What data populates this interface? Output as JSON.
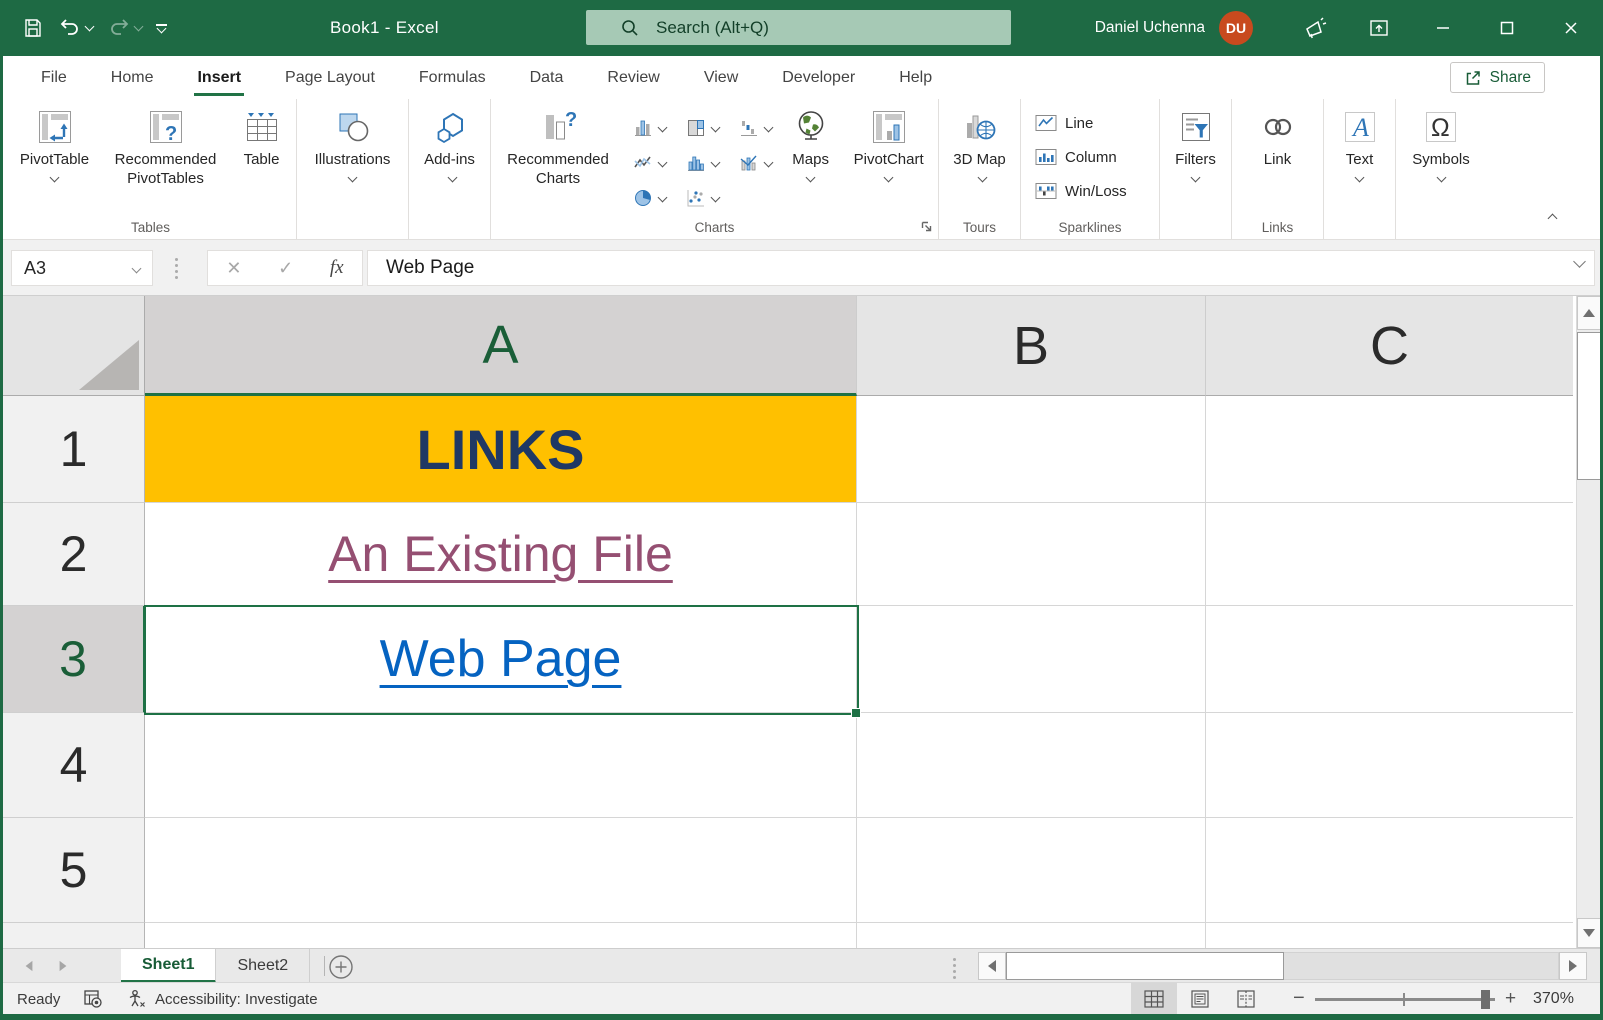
{
  "titlebar": {
    "title": "Book1 - Excel",
    "search_placeholder": "Search (Alt+Q)",
    "user_name": "Daniel Uchenna",
    "user_initials": "DU"
  },
  "tabs": {
    "file": "File",
    "home": "Home",
    "insert": "Insert",
    "page_layout": "Page Layout",
    "formulas": "Formulas",
    "data": "Data",
    "review": "Review",
    "view": "View",
    "developer": "Developer",
    "help": "Help",
    "active_tab": "Insert",
    "share": "Share"
  },
  "ribbon": {
    "pivottable": "PivotTable",
    "recommended_pivottables": "Recommended PivotTables",
    "table": "Table",
    "group_tables": "Tables",
    "illustrations": "Illustrations",
    "addins": "Add-ins",
    "recommended_charts": "Recommended Charts",
    "maps": "Maps",
    "pivotchart": "PivotChart",
    "group_charts": "Charts",
    "map3d": "3D Map",
    "group_tours": "Tours",
    "spark_line": "Line",
    "spark_column": "Column",
    "spark_winloss": "Win/Loss",
    "group_sparklines": "Sparklines",
    "filters": "Filters",
    "link": "Link",
    "group_links": "Links",
    "text": "Text",
    "symbols": "Symbols"
  },
  "formula_bar": {
    "cell_ref": "A3",
    "fx": "fx",
    "value": "Web Page"
  },
  "grid": {
    "col_a": "A",
    "col_b": "B",
    "col_c": "C",
    "selected_cell": "A3",
    "rows": [
      {
        "n": "1",
        "a": "LINKS"
      },
      {
        "n": "2",
        "a": "An Existing File"
      },
      {
        "n": "3",
        "a": "Web Page"
      },
      {
        "n": "4",
        "a": ""
      },
      {
        "n": "5",
        "a": ""
      }
    ]
  },
  "sheets": {
    "sheet1": "Sheet1",
    "sheet2": "Sheet2",
    "active": "Sheet1"
  },
  "status": {
    "mode": "Ready",
    "accessibility": "Accessibility: Investigate",
    "zoom": "370%"
  },
  "colors": {
    "titlebar_green": "#1E6A44",
    "accent_green": "#217346",
    "sheet_tab_green": "#185C37",
    "header_fill": "#FFC000",
    "header_text": "#1F3864",
    "visited_link": "#954F72",
    "hyperlink": "#0563C1",
    "selection_border": "#1E7145",
    "avatar_bg": "#C84A1E"
  }
}
